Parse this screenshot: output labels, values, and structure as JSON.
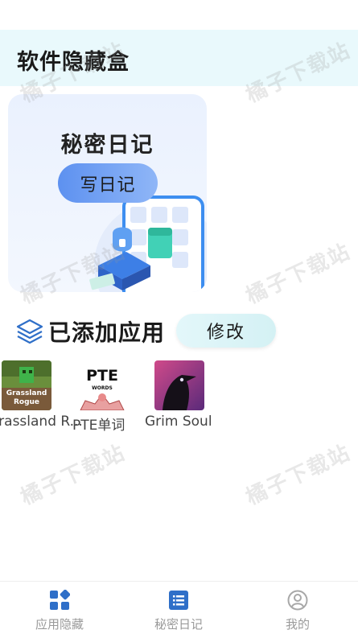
{
  "header": {
    "title": "软件隐藏盒"
  },
  "diary_card": {
    "title": "秘密日记",
    "button_label": "写日记"
  },
  "section": {
    "title": "已添加应用",
    "modify_label": "修改"
  },
  "apps": [
    {
      "label": "Grassland R...",
      "icon_text_1": "Grassland",
      "icon_text_2": "Rogue",
      "icon": "grassland-rogue-icon"
    },
    {
      "label": "PTE单词",
      "icon_text_1": "PTE",
      "icon_text_2": "WORDS",
      "icon": "pte-words-icon"
    },
    {
      "label": "Grim Soul",
      "icon": "grim-soul-raven-icon"
    }
  ],
  "watermark": "橘子下载站",
  "bottom_nav": {
    "items": [
      {
        "label": "应用隐藏",
        "icon": "apps-grid-icon"
      },
      {
        "label": "秘密日记",
        "icon": "list-icon"
      },
      {
        "label": "我的",
        "icon": "user-icon"
      }
    ]
  },
  "colors": {
    "accent": "#2f6fc8",
    "header_bg": "#e9f9fc",
    "inactive": "#9a9a9a"
  }
}
